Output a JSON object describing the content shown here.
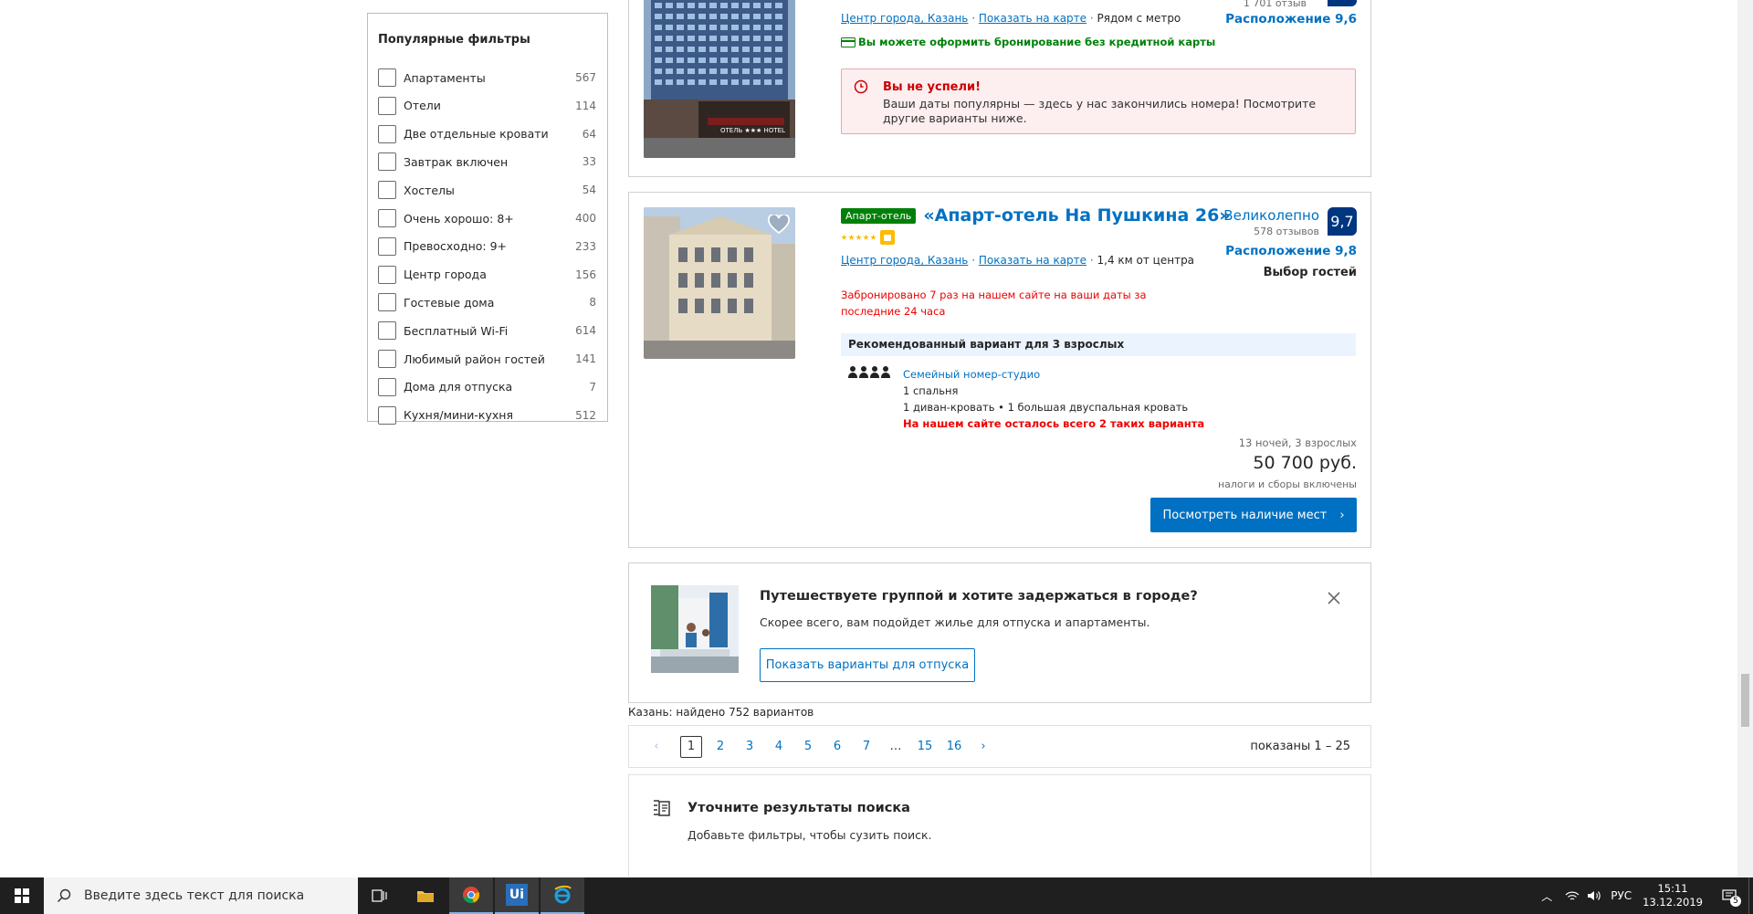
{
  "filters": {
    "title": "Популярные фильтры",
    "items": [
      {
        "label": "Апартаменты",
        "count": "567"
      },
      {
        "label": "Отели",
        "count": "114"
      },
      {
        "label": "Две отдельные кровати",
        "count": "64"
      },
      {
        "label": "Завтрак включен",
        "count": "33"
      },
      {
        "label": "Хостелы",
        "count": "54"
      },
      {
        "label": "Очень хорошо: 8+",
        "count": "400"
      },
      {
        "label": "Превосходно: 9+",
        "count": "233"
      },
      {
        "label": "Центр города",
        "count": "156"
      },
      {
        "label": "Гостевые дома",
        "count": "8"
      },
      {
        "label": "Бесплатный Wi-Fi",
        "count": "614"
      },
      {
        "label": "Любимый район гостей",
        "count": "141"
      },
      {
        "label": "Дома для отпуска",
        "count": "7"
      },
      {
        "label": "Кухня/мини-кухня",
        "count": "512"
      }
    ]
  },
  "hotel1": {
    "reviews": "1 701 отзыв",
    "district": "Центр города, Казань",
    "map_link": "Показать на карте",
    "near": "Рядом с метро",
    "location_score": "Расположение 9,6",
    "no_card": "Вы можете оформить бронирование без кредитной карты",
    "alert_title": "Вы не успели!",
    "alert_text": "Ваши даты популярны — здесь у нас закончились номера! Посмотрите другие варианты ниже.",
    "photo_sign": "ОТЕЛЬ ★★★ HOTEL"
  },
  "hotel2": {
    "type_badge": "Апарт-отель",
    "name": "«Апарт-отель На Пушкина 26»",
    "district": "Центр города, Казань",
    "map_link": "Показать на карте",
    "distance": "1,4 км от центра",
    "booked_text": "Забронировано 7 раз на нашем сайте на ваши даты за последние 24 часа",
    "rating_word": "Великолепно",
    "reviews": "578 отзывов",
    "score": "9,7",
    "location_score": "Расположение 9,8",
    "guests_choice": "Выбор гостей",
    "rec_title": "Рекомендованный вариант для 3 взрослых",
    "room_name": "Семейный номер-студио",
    "room_bedrooms": "1 спальня",
    "room_beds": "1 диван-кровать • 1 большая двуспальная кровать",
    "room_left": "На нашем сайте осталось всего 2 таких варианта",
    "nights": "13 ночей, 3 взрослых",
    "price": "50 700 руб.",
    "tax": "налоги и сборы включены",
    "cta": "Посмотреть наличие мест"
  },
  "promo": {
    "title": "Путешествуете группой и хотите задержаться в городе?",
    "text": "Скорее всего, вам подойдет жилье для отпуска и апартаменты.",
    "button": "Показать варианты для отпуска"
  },
  "results": {
    "found": "Казань: найдено 752 вариантов",
    "pages": [
      "1",
      "2",
      "3",
      "4",
      "5",
      "6",
      "7",
      "…",
      "15",
      "16"
    ],
    "shown": "показаны 1 – 25"
  },
  "refine": {
    "title": "Уточните результаты поиска",
    "text": "Добавьте фильтры, чтобы сузить поиск."
  },
  "taskbar": {
    "search_placeholder": "Введите здесь текст для поиска",
    "lang": "РУС",
    "time": "15:11",
    "date": "13.12.2019",
    "notif_count": "5"
  },
  "colors": {
    "accent": "#0071c2",
    "score_bg": "#003580",
    "badge_green": "#008009",
    "alert_red": "#cc0000"
  }
}
